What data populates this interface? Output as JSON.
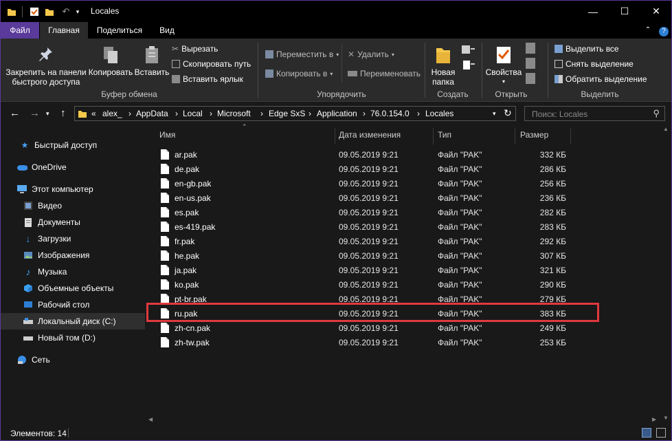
{
  "window": {
    "title": "Locales",
    "controls": [
      "—",
      "☐",
      "✕"
    ]
  },
  "ribbon_tabs": [
    "Файл",
    "Главная",
    "Поделиться",
    "Вид"
  ],
  "ribbon": {
    "pin": "Закрепить на панели быстрого доступа",
    "pin_l1": "Закрепить на панели",
    "pin_l2": "быстрого доступа",
    "copy": "Копировать",
    "paste": "Вставить",
    "cut": "Вырезать",
    "copy_path": "Скопировать путь",
    "paste_shortcut": "Вставить ярлык",
    "clipboard_group": "Буфер обмена",
    "move_to": "Переместить в",
    "copy_to": "Копировать в",
    "delete": "Удалить",
    "rename": "Переименовать",
    "organize_group": "Упорядочить",
    "new_folder_l1": "Новая",
    "new_folder_l2": "папка",
    "create_group": "Создать",
    "properties": "Свойства",
    "open_group": "Открыть",
    "select_all": "Выделить все",
    "select_none": "Снять выделение",
    "invert_selection": "Обратить выделение",
    "select_group": "Выделить"
  },
  "address": {
    "crumbs": [
      "alex_",
      "AppData",
      "Local",
      "Microsoft",
      "Edge SxS",
      "Application",
      "76.0.154.0",
      "Locales"
    ],
    "overflow": "«",
    "search_placeholder": "Поиск: Locales"
  },
  "nav": {
    "quick_access": "Быстрый доступ",
    "onedrive": "OneDrive",
    "this_pc": "Этот компьютер",
    "video": "Видео",
    "documents": "Документы",
    "downloads": "Загрузки",
    "pictures": "Изображения",
    "music": "Музыка",
    "objects3d": "Объемные объекты",
    "desktop": "Рабочий стол",
    "local_disk": "Локальный диск (C:)",
    "new_volume": "Новый том (D:)",
    "network": "Сеть"
  },
  "columns": {
    "name": "Имя",
    "date": "Дата изменения",
    "type": "Тип",
    "size": "Размер"
  },
  "files": [
    {
      "name": "ar.pak",
      "date": "09.05.2019 9:21",
      "type": "Файл \"PAK\"",
      "size": "332 КБ"
    },
    {
      "name": "de.pak",
      "date": "09.05.2019 9:21",
      "type": "Файл \"PAK\"",
      "size": "286 КБ"
    },
    {
      "name": "en-gb.pak",
      "date": "09.05.2019 9:21",
      "type": "Файл \"PAK\"",
      "size": "256 КБ"
    },
    {
      "name": "en-us.pak",
      "date": "09.05.2019 9:21",
      "type": "Файл \"PAK\"",
      "size": "236 КБ"
    },
    {
      "name": "es.pak",
      "date": "09.05.2019 9:21",
      "type": "Файл \"PAK\"",
      "size": "282 КБ"
    },
    {
      "name": "es-419.pak",
      "date": "09.05.2019 9:21",
      "type": "Файл \"PAK\"",
      "size": "283 КБ"
    },
    {
      "name": "fr.pak",
      "date": "09.05.2019 9:21",
      "type": "Файл \"PAK\"",
      "size": "292 КБ"
    },
    {
      "name": "he.pak",
      "date": "09.05.2019 9:21",
      "type": "Файл \"PAK\"",
      "size": "307 КБ"
    },
    {
      "name": "ja.pak",
      "date": "09.05.2019 9:21",
      "type": "Файл \"PAK\"",
      "size": "321 КБ"
    },
    {
      "name": "ko.pak",
      "date": "09.05.2019 9:21",
      "type": "Файл \"PAK\"",
      "size": "290 КБ"
    },
    {
      "name": "pt-br.pak",
      "date": "09.05.2019 9:21",
      "type": "Файл \"PAK\"",
      "size": "279 КБ"
    },
    {
      "name": "ru.pak",
      "date": "09.05.2019 9:21",
      "type": "Файл \"PAK\"",
      "size": "383 КБ"
    },
    {
      "name": "zh-cn.pak",
      "date": "09.05.2019 9:21",
      "type": "Файл \"PAK\"",
      "size": "249 КБ"
    },
    {
      "name": "zh-tw.pak",
      "date": "09.05.2019 9:21",
      "type": "Файл \"PAK\"",
      "size": "253 КБ"
    }
  ],
  "status": {
    "items_count": "Элементов: 14"
  },
  "colors": {
    "accent": "#5a3a9a",
    "highlight_box": "#e0393e",
    "background": "#191919",
    "ribbon": "#2b2b2b"
  }
}
